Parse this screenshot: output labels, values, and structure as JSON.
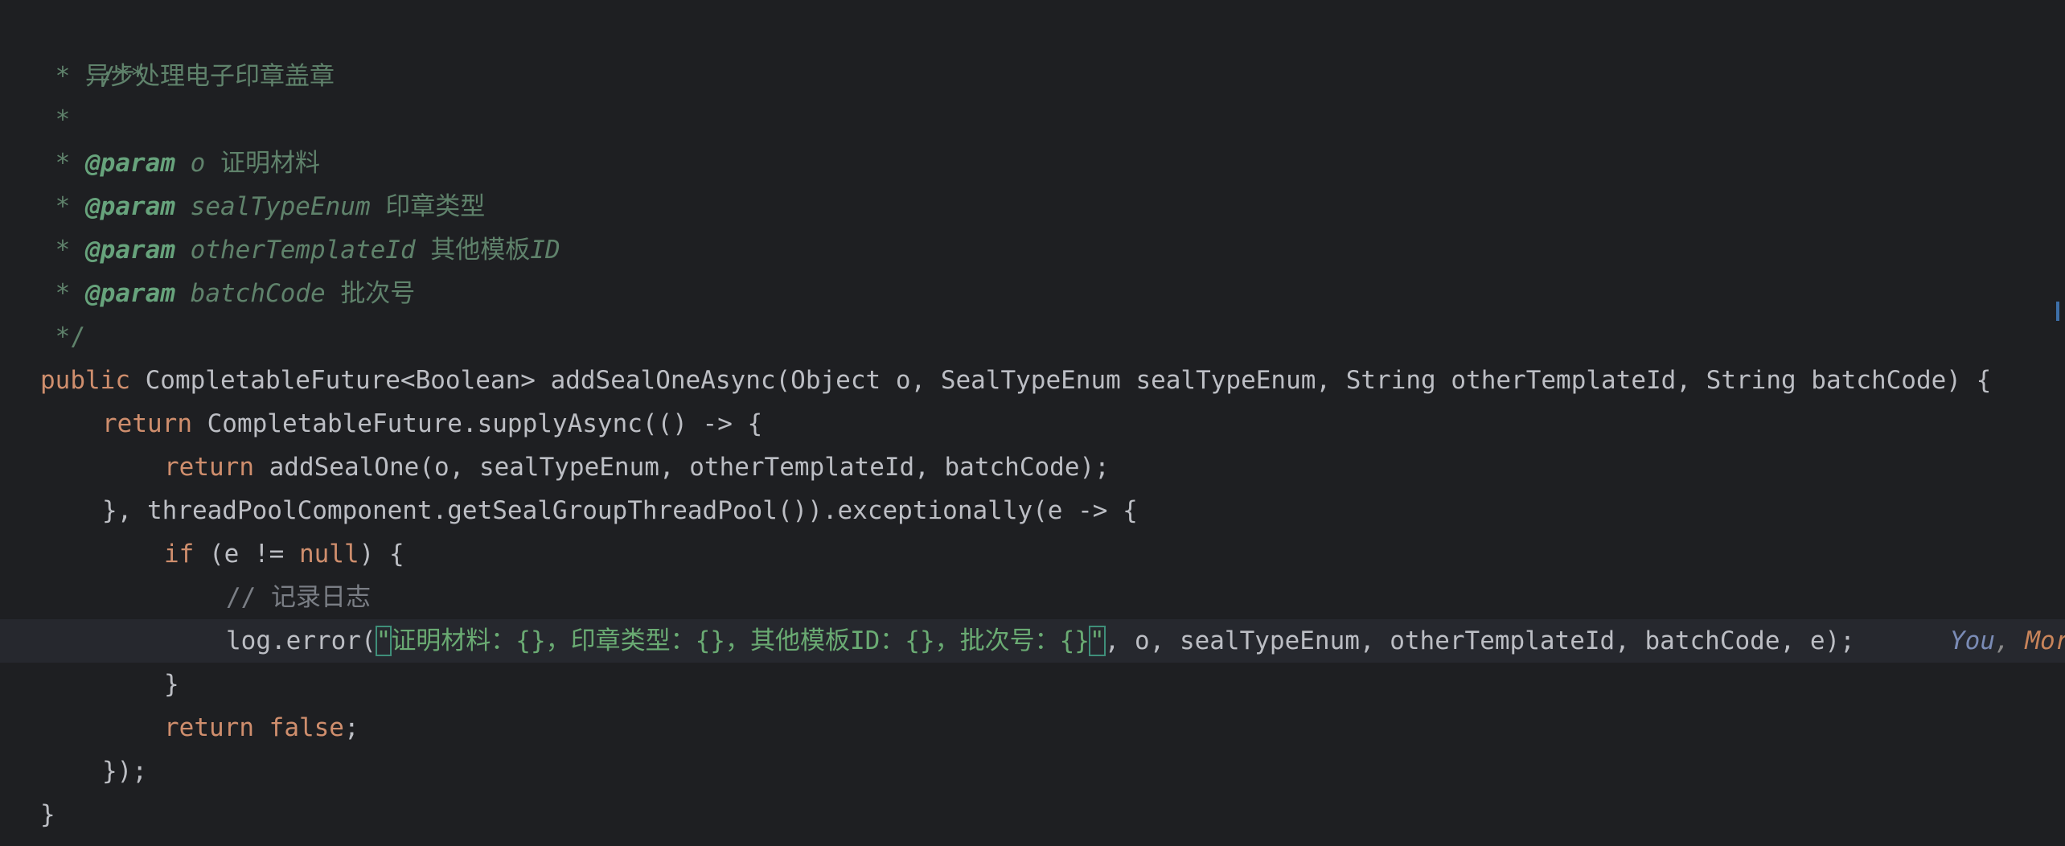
{
  "code": {
    "lines": [
      {
        "text": "/**"
      },
      {
        "star": " * ",
        "text": "异步处理电子印章盖章"
      },
      {
        "text": " *"
      },
      {
        "star": " * ",
        "tag": "@param",
        "param": "o",
        "desc": "证明材料"
      },
      {
        "star": " * ",
        "tag": "@param",
        "param": "sealTypeEnum",
        "desc": "印章类型"
      },
      {
        "star": " * ",
        "tag": "@param",
        "param": "otherTemplateId",
        "desc": "其他模板",
        "desc_italic": "ID"
      },
      {
        "star": " * ",
        "tag": "@param",
        "param": "batchCode",
        "desc": "批次号"
      },
      {
        "text": " */"
      },
      {
        "kw": "public",
        "rest": " CompletableFuture<Boolean> addSealOneAsync(Object o, SealTypeEnum sealTypeEnum, String otherTemplateId, String batchCode) {"
      },
      {
        "kw": "return",
        "rest": " CompletableFuture.supplyAsync(() -> {"
      },
      {
        "kw": "return",
        "rest": " addSealOne(o, sealTypeEnum, otherTemplateId, batchCode);"
      },
      {
        "text": "}, threadPoolComponent.getSealGroupThreadPool()).exceptionally(e -> {"
      },
      {
        "kw": "if",
        "mid": " (e != ",
        "kw2": "null",
        "rest": ") {"
      },
      {
        "text": "// 记录日志"
      },
      {
        "pre": "log.error(",
        "q1": "\"",
        "str": "证明材料：{}，印章类型：{}，其他模板ID：{}，批次号：{}",
        "q2": "\"",
        "rest": ", o, sealTypeEnum, otherTemplateId, batchCode, e);"
      },
      {
        "text": "}"
      },
      {
        "kw": "return",
        "sp": " ",
        "kw2": "false",
        "rest": ";"
      },
      {
        "text": "});"
      },
      {
        "text": "}"
      }
    ],
    "inlay": {
      "author": "You",
      "sep": ",",
      "more": " Mor"
    }
  },
  "colors": {
    "background": "#1e1f22",
    "current_line": "#26282e",
    "comment": "#5f826b",
    "keyword": "#cf8e6d",
    "string": "#6aab73",
    "text": "#bcbec4"
  }
}
